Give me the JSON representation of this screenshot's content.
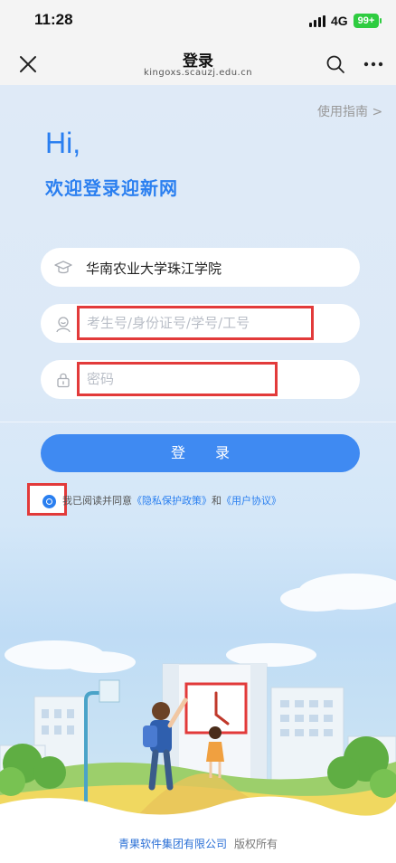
{
  "status_bar": {
    "time": "11:28",
    "network": "4G",
    "battery": "99+"
  },
  "nav": {
    "title": "登录",
    "subtitle": "kingoxs.scauzj.edu.cn",
    "close_icon": "close-icon",
    "search_icon": "search-icon",
    "more_icon": "more-icon"
  },
  "page": {
    "guide_link": "使用指南 >",
    "greeting": "Hi,",
    "welcome": "欢迎登录迎新网"
  },
  "form": {
    "school": {
      "value": "华南农业大学珠江学院",
      "icon": "graduation-cap-icon"
    },
    "account": {
      "placeholder": "考生号/身份证号/学号/工号",
      "icon": "user-icon"
    },
    "password": {
      "placeholder": "密码",
      "icon": "lock-icon"
    },
    "login_label": "登 录"
  },
  "agreement": {
    "checked": true,
    "prefix": "我已阅读并同意",
    "privacy_link": "《隐私保护政策》",
    "middle": "和",
    "user_link": "《用户协议》"
  },
  "footer": {
    "company": "青果软件集团有限公司",
    "rights": "版权所有"
  },
  "colors": {
    "accent": "#2a7ff0",
    "button": "#3f8af2",
    "highlight_border": "#e23a3a",
    "battery": "#2ecc40"
  }
}
